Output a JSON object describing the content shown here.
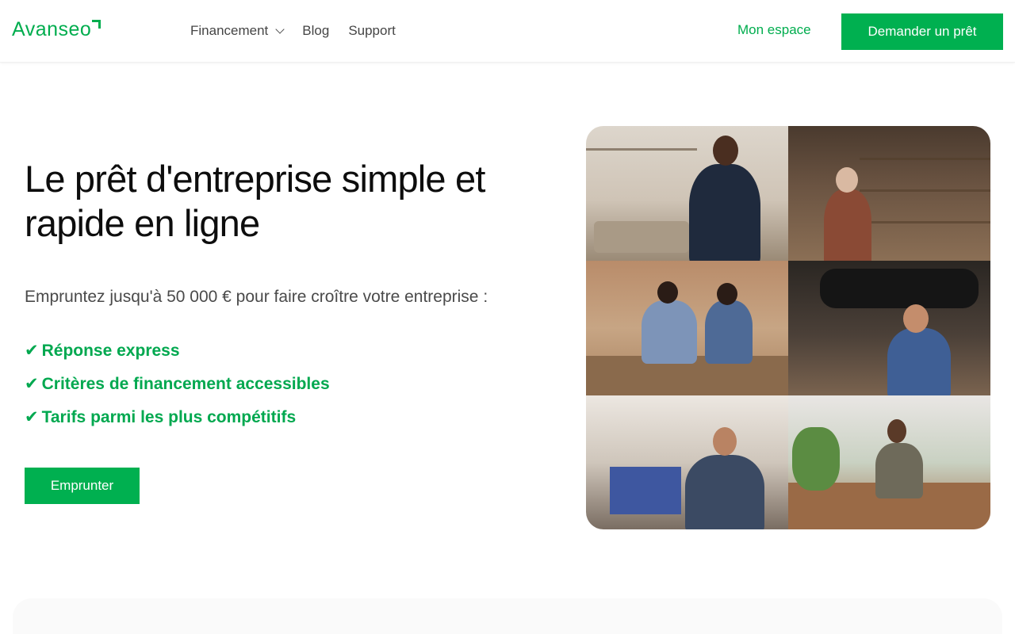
{
  "header": {
    "logo_text": "Avanseo",
    "nav": {
      "financement": "Financement",
      "blog": "Blog",
      "support": "Support"
    },
    "mon_espace": "Mon espace",
    "cta": "Demander un prêt"
  },
  "hero": {
    "title": "Le prêt d'entreprise simple et rapide en ligne",
    "subtitle": "Empruntez jusqu'à 50 000 € pour faire croître votre entreprise :",
    "bullets": [
      "Réponse express",
      "Critères de financement accessibles",
      "Tarifs parmi les plus compétitifs"
    ],
    "check_glyph": "✔",
    "cta": "Emprunter"
  },
  "photos": [
    {
      "alt": "shop-owner-icon"
    },
    {
      "alt": "pottery-owner-icon"
    },
    {
      "alt": "packaging-entrepreneurs-icon"
    },
    {
      "alt": "mechanic-icon"
    },
    {
      "alt": "workshop-owner-icon"
    },
    {
      "alt": "florist-icon"
    }
  ],
  "colors": {
    "brand": "#00ad4e",
    "button": "#00b050",
    "text": "#0d0d0d",
    "muted": "#4a4a4a"
  }
}
